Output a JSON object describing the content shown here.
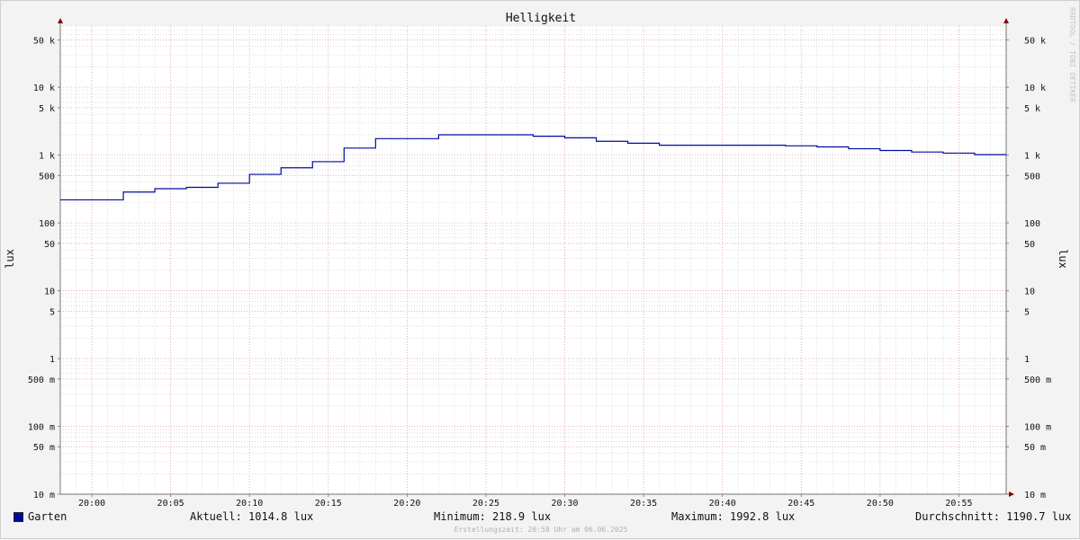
{
  "chart_data": {
    "type": "line",
    "title": "Helligkeit",
    "ylabel_left": "lux",
    "ylabel_right": "lux",
    "y_scale": "log",
    "ylim": [
      0.01,
      80000
    ],
    "y_ticks": [
      {
        "value": 50000,
        "label": "50 k"
      },
      {
        "value": 10000,
        "label": "10 k"
      },
      {
        "value": 5000,
        "label": "5 k"
      },
      {
        "value": 1000,
        "label": "1 k"
      },
      {
        "value": 500,
        "label": "500"
      },
      {
        "value": 100,
        "label": "100"
      },
      {
        "value": 50,
        "label": "50"
      },
      {
        "value": 10,
        "label": "10"
      },
      {
        "value": 5,
        "label": "5"
      },
      {
        "value": 1,
        "label": "1"
      },
      {
        "value": 0.5,
        "label": "500 m"
      },
      {
        "value": 0.1,
        "label": "100 m"
      },
      {
        "value": 0.05,
        "label": "50 m"
      },
      {
        "value": 0.01,
        "label": "10 m"
      }
    ],
    "x_ticks": [
      "20:00",
      "20:05",
      "20:10",
      "20:15",
      "20:20",
      "20:25",
      "20:30",
      "20:35",
      "20:40",
      "20:45",
      "20:50",
      "20:55"
    ],
    "x_range": [
      "19:58",
      "20:58"
    ],
    "grid": true,
    "series": [
      {
        "name": "Garten",
        "color": "#000aa0",
        "step": true,
        "points": [
          {
            "t": "19:58",
            "v": 218.9
          },
          {
            "t": "20:02",
            "v": 285
          },
          {
            "t": "20:04",
            "v": 320
          },
          {
            "t": "20:06",
            "v": 335
          },
          {
            "t": "20:08",
            "v": 385
          },
          {
            "t": "20:10",
            "v": 520
          },
          {
            "t": "20:12",
            "v": 650
          },
          {
            "t": "20:14",
            "v": 800
          },
          {
            "t": "20:16",
            "v": 1270
          },
          {
            "t": "20:18",
            "v": 1750
          },
          {
            "t": "20:22",
            "v": 1992.8
          },
          {
            "t": "20:28",
            "v": 1900
          },
          {
            "t": "20:30",
            "v": 1800
          },
          {
            "t": "20:32",
            "v": 1600
          },
          {
            "t": "20:34",
            "v": 1500
          },
          {
            "t": "20:36",
            "v": 1400
          },
          {
            "t": "20:44",
            "v": 1370
          },
          {
            "t": "20:46",
            "v": 1320
          },
          {
            "t": "20:48",
            "v": 1240
          },
          {
            "t": "20:50",
            "v": 1170
          },
          {
            "t": "20:52",
            "v": 1110
          },
          {
            "t": "20:54",
            "v": 1070
          },
          {
            "t": "20:56",
            "v": 1014.8
          },
          {
            "t": "20:58",
            "v": 1014.8
          }
        ]
      }
    ]
  },
  "legend": {
    "series_name": "Garten",
    "current": "Aktuell: 1014.8 lux",
    "minimum": "Minimum: 218.9 lux",
    "maximum": "Maximum: 1992.8 lux",
    "average": "Durchschnitt: 1190.7 lux"
  },
  "footer": {
    "created": "Erstellungszeit: 20:58 Uhr am 06.06.2025",
    "watermark": "RRDTOOL / TOBI OETIKER"
  },
  "colors": {
    "background": "#f3f3f3",
    "plot_background": "#ffffff",
    "major_grid": "#e8a0a8",
    "minor_grid": "#c8c8c8",
    "line": "#000aa0",
    "axis_arrow": "#8b0000"
  }
}
